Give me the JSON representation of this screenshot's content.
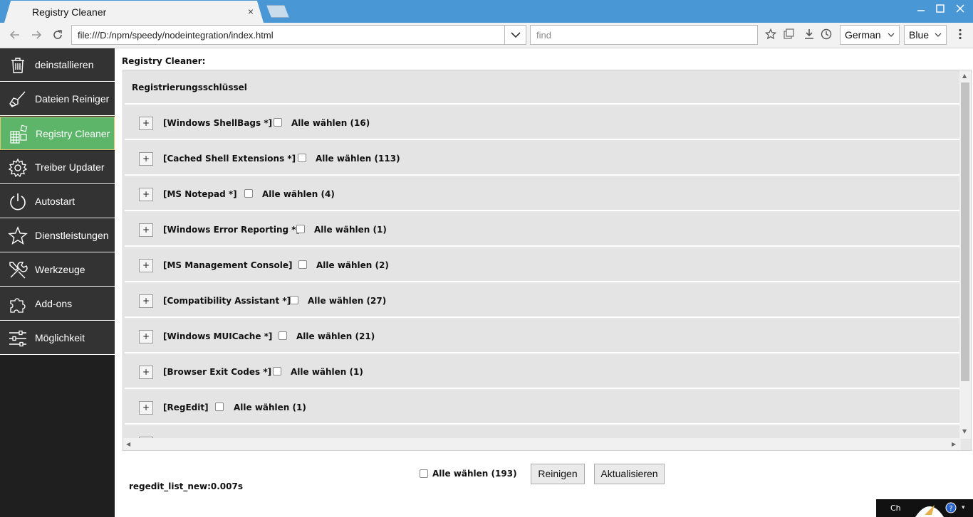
{
  "window": {
    "tab_title": "Registry Cleaner",
    "tab_close": "×"
  },
  "toolbar": {
    "url": "file:///D:/npm/speedy/nodeintegration/index.html",
    "find_placeholder": "find",
    "language": "German",
    "theme": "Blue"
  },
  "sidebar": {
    "items": [
      {
        "label": "deinstallieren",
        "icon": "trash-icon"
      },
      {
        "label": "Dateien Reiniger",
        "icon": "broom-icon"
      },
      {
        "label": "Registry Cleaner",
        "icon": "registry-blocks-icon",
        "active": true
      },
      {
        "label": "Treiber Updater",
        "icon": "gear-icon"
      },
      {
        "label": "Autostart",
        "icon": "power-icon"
      },
      {
        "label": "Dienstleistungen",
        "icon": "star-icon"
      },
      {
        "label": "Werkzeuge",
        "icon": "tools-icon"
      },
      {
        "label": "Add-ons",
        "icon": "puzzle-icon"
      },
      {
        "label": "Möglichkeit",
        "icon": "sliders-icon"
      }
    ]
  },
  "main": {
    "title": "Registry Cleaner:",
    "header": "Registrierungsschlüssel",
    "rows": [
      {
        "name": "[Windows ShellBags *]",
        "select_label": "Alle wählen (16)"
      },
      {
        "name": "[Cached Shell Extensions *]",
        "select_label": "Alle wählen (113)"
      },
      {
        "name": "[MS Notepad *]",
        "select_label": "Alle wählen (4)"
      },
      {
        "name": "[Windows Error Reporting *]",
        "select_label": "Alle wählen (1)"
      },
      {
        "name": "[MS Management Console]",
        "select_label": "Alle wählen (2)"
      },
      {
        "name": "[Compatibility Assistant *]",
        "select_label": "Alle wählen (27)"
      },
      {
        "name": "[Windows MUICache *]",
        "select_label": "Alle wählen (21)"
      },
      {
        "name": "[Browser Exit Codes *]",
        "select_label": "Alle wählen (1)"
      },
      {
        "name": "[RegEdit]",
        "select_label": "Alle wählen (1)"
      }
    ],
    "expand_label": "+"
  },
  "footer": {
    "select_all": "Alle wählen (193)",
    "clean_button": "Reinigen",
    "refresh_button": "Aktualisieren",
    "status": "regedit_list_new:0.007s"
  },
  "tray": {
    "text": "Ch"
  },
  "colors": {
    "titlebar": "#4a97d6",
    "sidebar_bg": "#333333",
    "active_item": "#5db56a",
    "panel_bg": "#e6e6e6"
  }
}
